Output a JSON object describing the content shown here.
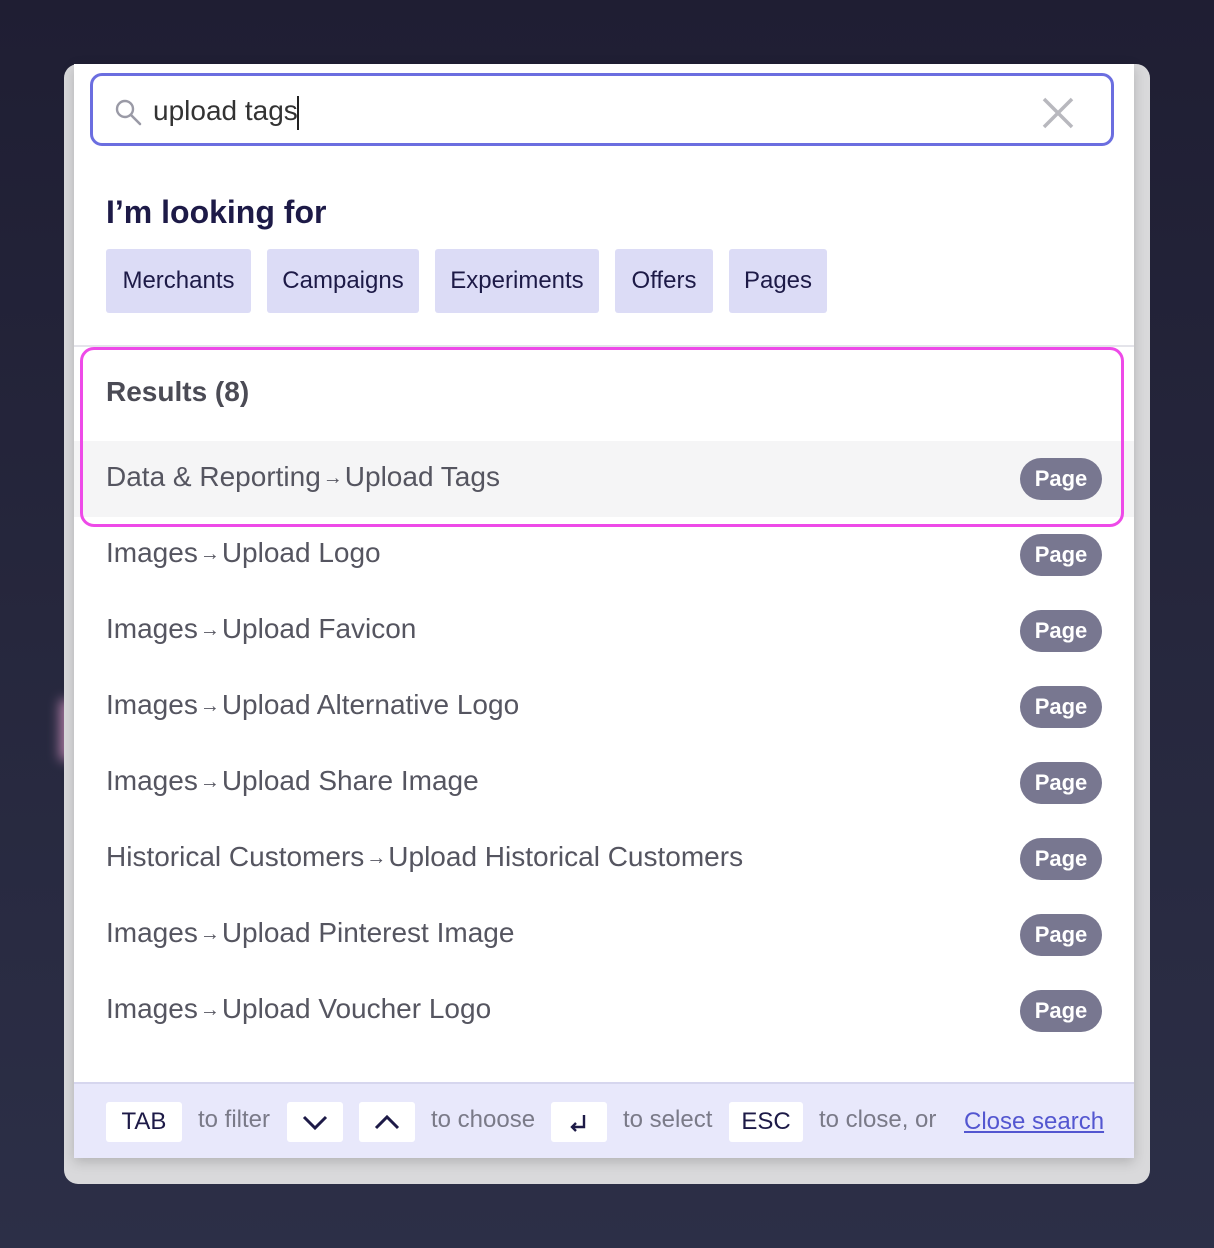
{
  "search": {
    "value": "upload tags",
    "icons": {
      "search": "search-icon",
      "clear": "close-icon"
    }
  },
  "filters": {
    "title": "I’m looking for",
    "chips": [
      "Merchants",
      "Campaigns",
      "Experiments",
      "Offers",
      "Pages"
    ]
  },
  "results": {
    "title": "Results (8)",
    "items": [
      {
        "parent": "Data & Reporting",
        "page": "Upload Tags",
        "badge": "Page"
      },
      {
        "parent": "Images",
        "page": "Upload Logo",
        "badge": "Page"
      },
      {
        "parent": "Images",
        "page": "Upload Favicon",
        "badge": "Page"
      },
      {
        "parent": "Images",
        "page": "Upload Alternative Logo",
        "badge": "Page"
      },
      {
        "parent": "Images",
        "page": "Upload Share Image",
        "badge": "Page"
      },
      {
        "parent": "Historical Customers",
        "page": "Upload Historical Customers",
        "badge": "Page"
      },
      {
        "parent": "Images",
        "page": "Upload Pinterest Image",
        "badge": "Page"
      },
      {
        "parent": "Images",
        "page": "Upload Voucher Logo",
        "badge": "Page"
      }
    ]
  },
  "footer": {
    "tab_key": "TAB",
    "tab_hint": "to filter",
    "choose_hint": "to choose",
    "select_hint": "to select",
    "esc_key": "ESC",
    "esc_hint": "to close, or",
    "close_link": "Close search"
  },
  "colors": {
    "accent": "#6b6ee0",
    "highlight": "#ee4ae8",
    "chip_bg": "#dcdcf6",
    "badge_bg": "#787790"
  }
}
